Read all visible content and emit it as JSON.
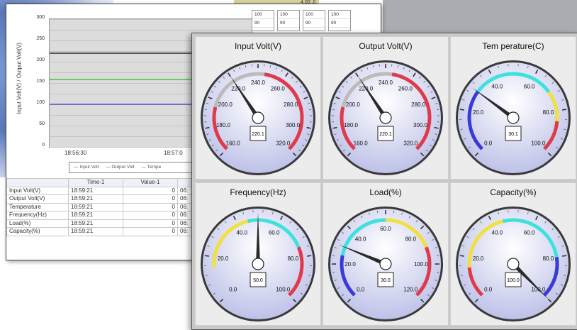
{
  "background": {
    "top_fragment": "4.00:.0"
  },
  "chart_window": {
    "chart_data": {
      "type": "line",
      "ylabel": "Input Volt(V) / Output Volt(V)",
      "yticks": [
        "300",
        "250",
        "200",
        "150",
        "100",
        "50",
        "0"
      ],
      "ylim": [
        0,
        300
      ],
      "xticks": [
        "18:56:30",
        "18:57:0"
      ],
      "series": [
        {
          "name": "Input Volt",
          "values": [
            220,
            220
          ],
          "color": "#555555"
        },
        {
          "name": "Output Volt",
          "values": [
            158,
            158
          ],
          "color": "#66cc66"
        },
        {
          "name": "Tempe",
          "values": [
            100,
            100
          ],
          "color": "#7a6cd6"
        }
      ],
      "grid": true
    },
    "legend_items": [
      "Input Volt",
      "Output Volt",
      "Tempe"
    ],
    "mini_columns": [
      {
        "a": "100",
        "b": "90"
      },
      {
        "a": "100",
        "b": "90"
      },
      {
        "a": "100",
        "b": "90"
      },
      {
        "a": "100",
        "b": "90"
      }
    ],
    "table": {
      "headers": [
        "",
        "Time-1",
        "Value-1",
        "T"
      ],
      "rows": [
        [
          "Input Volt(V)",
          "18:59:21",
          "0",
          "06:"
        ],
        [
          "Output Volt(V)",
          "18:59:21",
          "0",
          "06:"
        ],
        [
          "Temperature",
          "18:59:21",
          "0",
          "06:"
        ],
        [
          "Frequency(Hz)",
          "18:59:21",
          "0",
          "06:"
        ],
        [
          "Load(%)",
          "18:59:21",
          "0",
          "06:"
        ],
        [
          "Capacity(%)",
          "18:59:21",
          "0",
          "06:"
        ]
      ]
    }
  },
  "gauges": [
    {
      "title": "Input Volt(V)",
      "min": 160,
      "max": 320,
      "value": 220.1,
      "display": "220.1",
      "labels": [
        "160.0",
        "180.0",
        "200.0",
        "220.0",
        "240.0",
        "260.0",
        "280.0",
        "300.0",
        "320.0"
      ],
      "arcs": [
        {
          "from": 160,
          "to": 195,
          "color": "#e03a4a"
        },
        {
          "from": 195,
          "to": 245,
          "color": "#bbbbbb"
        },
        {
          "from": 245,
          "to": 320,
          "color": "#e03a4a"
        }
      ]
    },
    {
      "title": "Output Volt(V)",
      "min": 160,
      "max": 320,
      "value": 220.1,
      "display": "220.1",
      "labels": [
        "160.0",
        "180.0",
        "200.0",
        "220.0",
        "240.0",
        "260.0",
        "280.0",
        "300.0",
        "320.0"
      ],
      "arcs": [
        {
          "from": 160,
          "to": 195,
          "color": "#e03a4a"
        },
        {
          "from": 195,
          "to": 245,
          "color": "#bbbbbb"
        },
        {
          "from": 245,
          "to": 320,
          "color": "#e03a4a"
        }
      ]
    },
    {
      "title": "Tem perature(C)",
      "min": 0,
      "max": 100,
      "value": 30.1,
      "display": "30.1",
      "labels": [
        "0.0",
        "20.0",
        "40.0",
        "60.0",
        "80.0",
        "100.0"
      ],
      "arcs": [
        {
          "from": 0,
          "to": 30,
          "color": "#3a3ad6"
        },
        {
          "from": 30,
          "to": 70,
          "color": "#3fe0e0"
        },
        {
          "from": 70,
          "to": 85,
          "color": "#f0e040"
        },
        {
          "from": 85,
          "to": 100,
          "color": "#e03a4a"
        }
      ]
    },
    {
      "title": "Frequency(Hz)",
      "min": 0,
      "max": 100,
      "value": 50.0,
      "display": "50.0",
      "labels": [
        "0.0",
        "20.0",
        "40.0",
        "60.0",
        "80.0",
        "100.0"
      ],
      "arcs": [
        {
          "from": 15,
          "to": 45,
          "color": "#f0e040"
        },
        {
          "from": 45,
          "to": 75,
          "color": "#3fe0e0"
        },
        {
          "from": 75,
          "to": 100,
          "color": "#e03a4a"
        }
      ]
    },
    {
      "title": "Load(%)",
      "min": 0,
      "max": 120,
      "value": 30.0,
      "display": "30.0",
      "labels": [
        "0.0",
        "20.0",
        "40.0",
        "60.0",
        "80.0",
        "100.0",
        "120.0"
      ],
      "arcs": [
        {
          "from": 0,
          "to": 25,
          "color": "#3a3ad6"
        },
        {
          "from": 25,
          "to": 60,
          "color": "#3fe0e0"
        },
        {
          "from": 60,
          "to": 90,
          "color": "#f0e040"
        },
        {
          "from": 90,
          "to": 120,
          "color": "#e03a4a"
        }
      ]
    },
    {
      "title": "Capacity(%)",
      "min": 0,
      "max": 100,
      "value": 100.0,
      "display": "100.0",
      "labels": [
        "0.0",
        "20.0",
        "40.0",
        "60.0",
        "80.0",
        "100.0"
      ],
      "arcs": [
        {
          "from": 0,
          "to": 15,
          "color": "#e03a4a"
        },
        {
          "from": 15,
          "to": 45,
          "color": "#f0e040"
        },
        {
          "from": 45,
          "to": 80,
          "color": "#3fe0e0"
        },
        {
          "from": 80,
          "to": 100,
          "color": "#3a3ad6"
        }
      ]
    }
  ]
}
